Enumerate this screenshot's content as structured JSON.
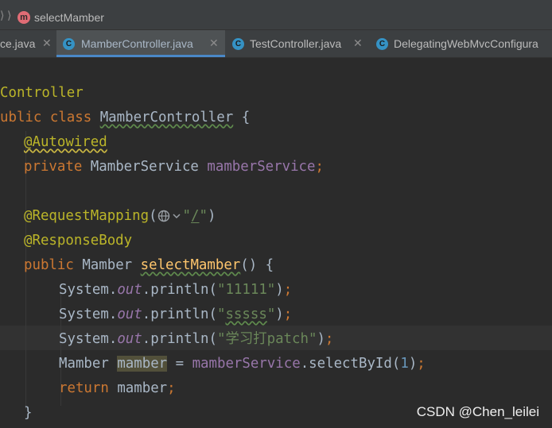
{
  "breadcrumb": {
    "method_badge": "m",
    "method_name": "selectMamber"
  },
  "tabs": [
    {
      "label": "ce.java",
      "active": false
    },
    {
      "label": "MamberController.java",
      "active": true,
      "icon_letter": "C"
    },
    {
      "label": "TestController.java",
      "active": false,
      "icon_letter": "C"
    },
    {
      "label": "DelegatingWebMvcConfigura",
      "active": false,
      "icon_letter": "C"
    }
  ],
  "code": {
    "line1": {
      "text": "Controller"
    },
    "line2": {
      "kw1": "ublic",
      "kw2": "class",
      "cls": "MamberController",
      "brace": "{"
    },
    "line3": {
      "ann": "@Autowired"
    },
    "line4": {
      "kw": "private",
      "type": "MamberService",
      "field": "mamberService",
      "semi": ";"
    },
    "line6": {
      "ann": "@RequestMapping",
      "open": "(",
      "quote_open": "\"",
      "path": "/",
      "quote_close": "\"",
      "close": ")"
    },
    "line7": {
      "ann": "@ResponseBody"
    },
    "line8": {
      "kw": "public",
      "type": "Mamber",
      "method": "selectMamber",
      "rest": "() {"
    },
    "line9": {
      "obj": "System",
      "dot1": ".",
      "field": "out",
      "call": ".println(",
      "str": "\"11111\"",
      "close": ")",
      "semi": ";"
    },
    "line10": {
      "obj": "System",
      "dot1": ".",
      "field": "out",
      "call": ".println(",
      "q1": "\"",
      "str_inner": "sssss",
      "q2": "\"",
      "close": ")",
      "semi": ";"
    },
    "line11": {
      "obj": "System",
      "dot1": ".",
      "field": "out",
      "call": ".println(",
      "str": "\"学习打patch\"",
      "close": ")",
      "semi": ";"
    },
    "line12": {
      "type": "Mamber",
      "var": "mamber",
      "eq": " = ",
      "field": "mamberService",
      "call": ".selectById(",
      "num": "1",
      "close": ")",
      "semi": ";"
    },
    "line13": {
      "kw": "return",
      "var": "mamber",
      "semi": ";"
    },
    "line14": {
      "brace": "}"
    }
  },
  "watermark": "CSDN @Chen_leilei",
  "colors": {
    "keyword": "#cc7832",
    "annotation": "#bbb529",
    "field": "#9876aa",
    "string": "#6a8759",
    "number": "#6897bb",
    "method": "#ffc66d",
    "default_text": "#a9b7c6",
    "editor_bg": "#2b2b2b",
    "tab_active_underline": "#4a88c7"
  },
  "icons": {
    "breadcrumb_separator": "chevron-right-icon",
    "method_badge": "method-m-icon",
    "tab_icon": "java-class-c-icon",
    "tab_close": "close-icon",
    "gutter_web": "globe-icon"
  }
}
